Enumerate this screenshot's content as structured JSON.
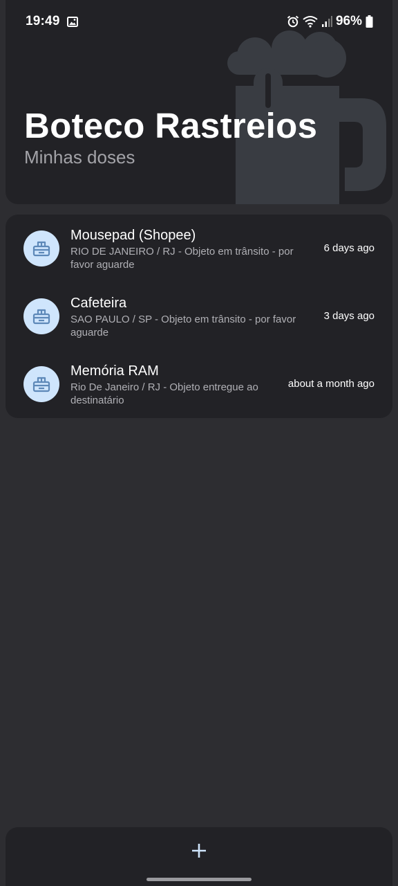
{
  "status_bar": {
    "time": "19:49",
    "battery": "96%",
    "icons": [
      "image-icon",
      "alarm-icon",
      "wifi-icon",
      "signal-icon",
      "battery-icon"
    ]
  },
  "header": {
    "title": "Boteco Rastreios",
    "subtitle": "Minhas doses",
    "background_icon": "beer-mug-icon"
  },
  "packages": [
    {
      "title": "Mousepad (Shopee)",
      "description": "RIO DE JANEIRO / RJ - Objeto em trânsito - por favor aguarde",
      "time": "6 days ago",
      "icon": "package-icon"
    },
    {
      "title": "Cafeteira",
      "description": "SAO PAULO / SP - Objeto em trânsito - por favor aguarde",
      "time": "3 days ago",
      "icon": "package-icon"
    },
    {
      "title": "Memória RAM",
      "description": "Rio De Janeiro / RJ - Objeto entregue ao destinatário",
      "time": "about a month ago",
      "icon": "package-icon"
    }
  ],
  "bottom_bar": {
    "add_icon": "plus-icon"
  },
  "colors": {
    "background": "#2d2d31",
    "card": "#222226",
    "accent": "#cfe5fc",
    "accent_icon": "#5d88b8",
    "beer_icon": "#393c42"
  }
}
